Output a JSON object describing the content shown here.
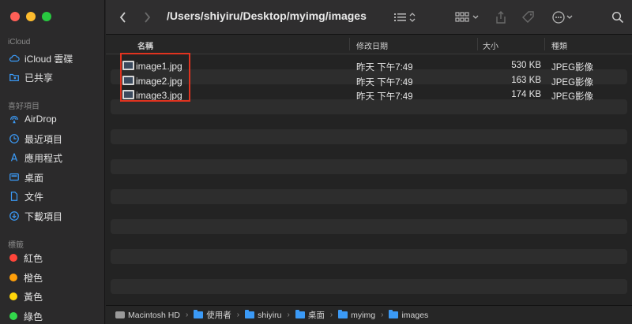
{
  "sidebar": {
    "sections": [
      {
        "label": "iCloud",
        "items": [
          {
            "label": "iCloud 雲碟",
            "icon": "cloud-icon"
          },
          {
            "label": "已共享",
            "icon": "shared-folder-icon"
          }
        ]
      },
      {
        "label": "喜好項目",
        "items": [
          {
            "label": "AirDrop",
            "icon": "airdrop-icon"
          },
          {
            "label": "最近項目",
            "icon": "clock-icon"
          },
          {
            "label": "應用程式",
            "icon": "applications-icon"
          },
          {
            "label": "桌面",
            "icon": "desktop-icon"
          },
          {
            "label": "文件",
            "icon": "document-icon"
          },
          {
            "label": "下載項目",
            "icon": "download-icon"
          }
        ]
      },
      {
        "label": "標籤",
        "items": [
          {
            "label": "紅色",
            "color": "#ff453a"
          },
          {
            "label": "橙色",
            "color": "#ff9f0a"
          },
          {
            "label": "黃色",
            "color": "#ffd60a"
          },
          {
            "label": "綠色",
            "color": "#32d74b"
          }
        ]
      }
    ]
  },
  "toolbar": {
    "title": "/Users/shiyiru/Desktop/myimg/images"
  },
  "columns": {
    "name": "名稱",
    "date": "修改日期",
    "size": "大小",
    "kind": "種類"
  },
  "files": [
    {
      "name": "image1.jpg",
      "date": "昨天 下午7:49",
      "size": "530 KB",
      "kind": "JPEG影像"
    },
    {
      "name": "image2.jpg",
      "date": "昨天 下午7:49",
      "size": "163 KB",
      "kind": "JPEG影像"
    },
    {
      "name": "image3.jpg",
      "date": "昨天 下午7:49",
      "size": "174 KB",
      "kind": "JPEG影像"
    }
  ],
  "pathbar": [
    "Macintosh HD",
    "使用者",
    "shiyiru",
    "桌面",
    "myimg",
    "images"
  ],
  "colors": {
    "accent": "#3b9af6",
    "highlight_box": "#e0331f"
  }
}
